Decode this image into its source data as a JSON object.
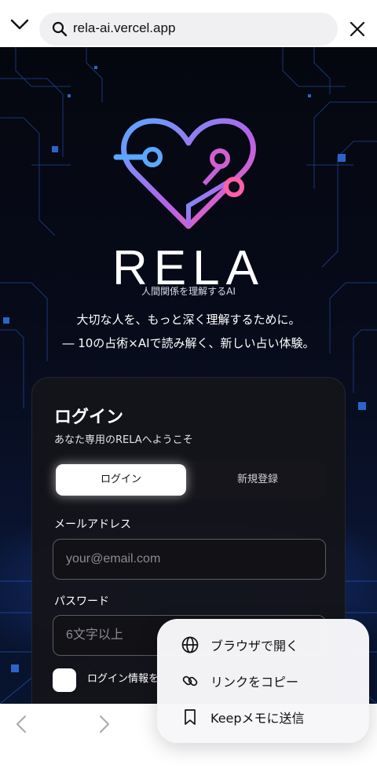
{
  "browser": {
    "url": "rela-ai.vercel.app",
    "icons": {
      "collapse": "chevron-down-icon",
      "search": "search-icon",
      "close": "close-icon"
    }
  },
  "hero": {
    "brand": "RELA",
    "brand_tagline": "人間関係を理解するAI",
    "tagline_1": "大切な人を、もっと深く理解するために。",
    "tagline_2": "― 10の占術×AIで読み解く、新しい占い体験。",
    "logo_icon": "circuit-heart-logo"
  },
  "login_card": {
    "title": "ログイン",
    "subtitle": "あなた専用のRELAへようこそ",
    "tabs": {
      "login": "ログイン",
      "register": "新規登録"
    },
    "email_label": "メールアドレス",
    "email_placeholder": "your@email.com",
    "password_label": "パスワード",
    "password_placeholder": "6文字以上",
    "remember_label": "ログイン情報を"
  },
  "bottom_nav": {
    "back_icon": "chevron-left-icon",
    "forward_icon": "chevron-right-icon"
  },
  "context_menu": {
    "items": [
      {
        "label": "ブラウザで開く",
        "icon": "globe-icon"
      },
      {
        "label": "リンクをコピー",
        "icon": "link-icon"
      },
      {
        "label": "Keepメモに送信",
        "icon": "bookmark-icon"
      }
    ]
  },
  "colors": {
    "heart_gradient_start": "#5aa8ff",
    "heart_gradient_end": "#ff5fa8",
    "page_bg": "#05070f",
    "accent_glow": "#1e5adc"
  }
}
